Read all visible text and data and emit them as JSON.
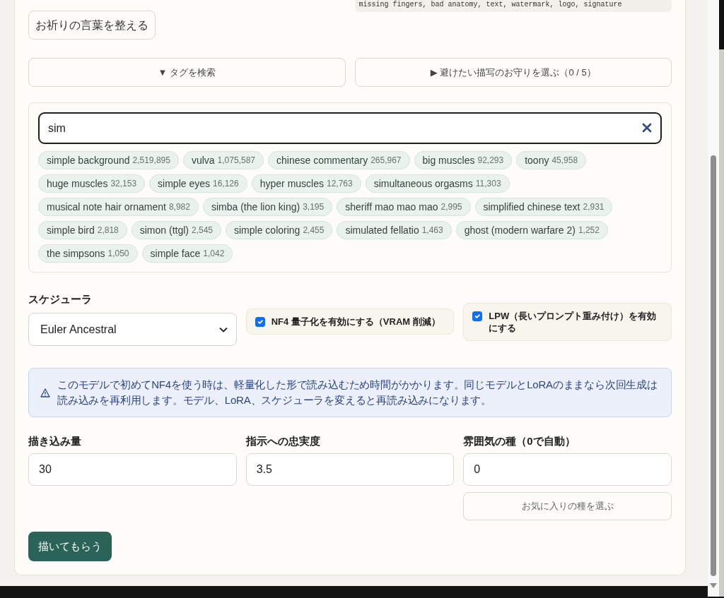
{
  "text_box": {
    "text": "missing fingers, bad anatomy, text, watermark, logo, signature"
  },
  "tidy_button": "お祈りの言葉を整える",
  "toggles": [
    {
      "label": "▼ タグを検索"
    },
    {
      "label": "▶ 避けたい描写のお守りを選ぶ（0 / 5）"
    }
  ],
  "tag_search": {
    "value": "sim",
    "tags": [
      {
        "name": "simple background",
        "count": "2,519,895"
      },
      {
        "name": "vulva",
        "count": "1,075,587"
      },
      {
        "name": "chinese commentary",
        "count": "265,967"
      },
      {
        "name": "big muscles",
        "count": "92,293"
      },
      {
        "name": "toony",
        "count": "45,958"
      },
      {
        "name": "huge muscles",
        "count": "32,153"
      },
      {
        "name": "simple eyes",
        "count": "16,126"
      },
      {
        "name": "hyper muscles",
        "count": "12,763"
      },
      {
        "name": "simultaneous orgasms",
        "count": "11,303"
      },
      {
        "name": "musical note hair ornament",
        "count": "8,982"
      },
      {
        "name": "simba (the lion king)",
        "count": "3,195"
      },
      {
        "name": "sheriff mao mao mao",
        "count": "2,995"
      },
      {
        "name": "simplified chinese text",
        "count": "2,931"
      },
      {
        "name": "simple bird",
        "count": "2,818"
      },
      {
        "name": "simon (ttgl)",
        "count": "2,545"
      },
      {
        "name": "simple coloring",
        "count": "2,455"
      },
      {
        "name": "simulated fellatio",
        "count": "1,463"
      },
      {
        "name": "ghost (modern warfare 2)",
        "count": "1,252"
      },
      {
        "name": "the simpsons",
        "count": "1,050"
      },
      {
        "name": "simple face",
        "count": "1,042"
      }
    ]
  },
  "scheduler": {
    "label": "スケジューラ",
    "value": "Euler Ancestral"
  },
  "options": [
    {
      "label": "NF4 量子化を有効にする（VRAM 削減）",
      "checked": true
    },
    {
      "label": "LPW（長いプロンプト重み付け）を有効にする",
      "checked": true
    }
  ],
  "notice": "このモデルで初めてNF4を使う時は、軽量化した形で読み込むため時間がかかります。同じモデルとLoRAのままなら次回生成は読み込みを再利用します。モデル、LoRA、スケジューラを変えると再読み込みになります。",
  "fields": [
    {
      "label": "描き込み量",
      "value": "30"
    },
    {
      "label": "指示への忠実度",
      "value": "3.5"
    },
    {
      "label": "雰囲気の種（0で自動）",
      "value": "0"
    }
  ],
  "seed_button": "お気に入りの種を選ぶ",
  "submit_button": "描いてもらう"
}
